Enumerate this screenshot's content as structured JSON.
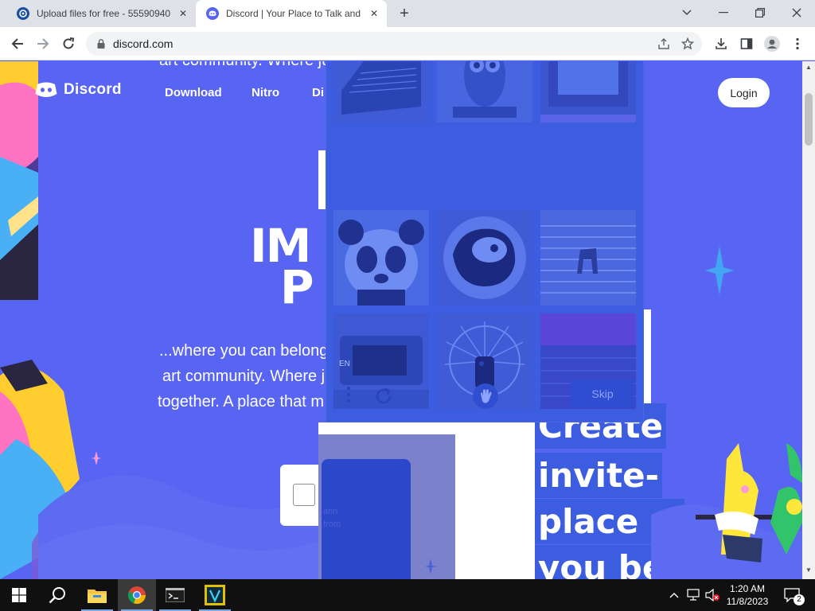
{
  "browser": {
    "tabs": [
      {
        "title": "Upload files for free - 55590940",
        "active": false
      },
      {
        "title": "Discord | Your Place to Talk and",
        "active": true
      }
    ],
    "new_tab_symbol": "+",
    "window_controls": [
      "chevron-down-icon",
      "minimize-icon",
      "restore-icon",
      "close-icon"
    ],
    "url": "discord.com"
  },
  "page": {
    "brand": "Discord",
    "nav": [
      "Download",
      "Nitro"
    ],
    "nav_cut": "Di",
    "login_label": "Login",
    "hero_cut_top": "art community. Where ju",
    "hero_title_line1": "IM",
    "hero_title_line2": "P",
    "hero_desc_lines": [
      "...where you can belong",
      "art community. Where j",
      "together. A place that m"
    ],
    "create_lines": [
      "Create",
      "invite-",
      "place w",
      "you be"
    ],
    "faded_texts": [
      "ann",
      "from"
    ]
  },
  "captcha": {
    "language": "EN",
    "skip_label": "Skip"
  },
  "taskbar": {
    "pinned": [
      "start-icon",
      "search-icon",
      "file-explorer-icon",
      "chrome-icon",
      "terminal-icon",
      "app-v-icon"
    ],
    "clock_time": "1:20 AM",
    "clock_date": "11/8/2023",
    "notification_count": "2"
  },
  "colors": {
    "discord_blurple": "#5865F2",
    "captcha_overlay": "#3d5de0",
    "taskbar": "#101010"
  }
}
